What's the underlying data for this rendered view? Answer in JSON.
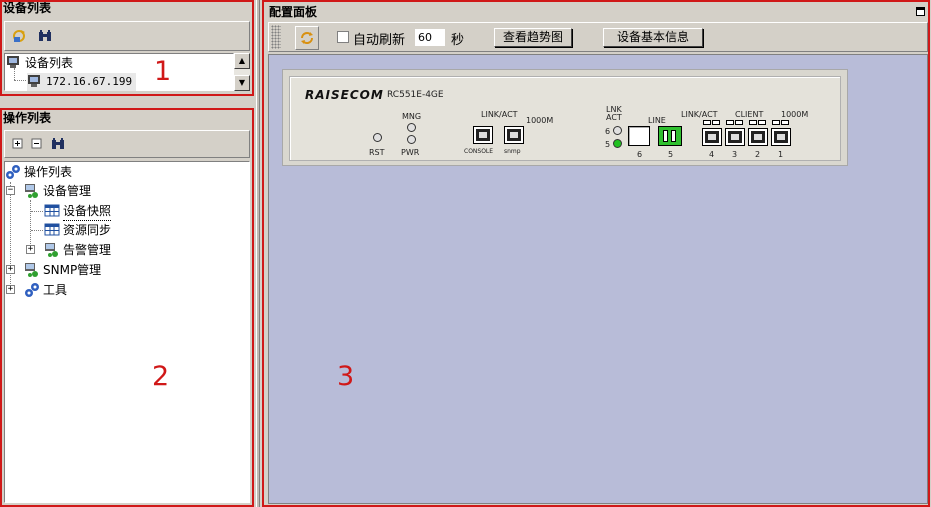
{
  "device_list_panel": {
    "title": "设备列表",
    "tree": {
      "root_label": "设备列表",
      "device_ip": "172.16.67.199"
    }
  },
  "operation_list_panel": {
    "title": "操作列表",
    "tree": {
      "root": "操作列表",
      "device_mgmt": "设备管理",
      "device_snapshot": "设备快照",
      "resource_sync": "资源同步",
      "alarm_mgmt": "告警管理",
      "snmp_mgmt": "SNMP管理",
      "tools": "工具"
    }
  },
  "config_panel": {
    "title": "配置面板",
    "auto_refresh_label": "自动刷新",
    "auto_refresh_checked": false,
    "refresh_interval": "60",
    "seconds_label": "秒",
    "trend_button": "查看趋势图",
    "device_info_button": "设备基本信息"
  },
  "device": {
    "brand": "RAISECOM",
    "model": "RC551E-4GE",
    "labels": {
      "mng": "MNG",
      "rst": "RST",
      "pwr": "PWR",
      "link_act_left": "LINK/ACT",
      "speed_left": "1000M",
      "console": "CONSOLE",
      "snmp": "snmp",
      "lnk": "LNK",
      "act": "ACT",
      "led6": "6",
      "led5": "5",
      "line": "LINE",
      "port6": "6",
      "port5": "5",
      "link_act_right": "LINK/ACT",
      "client": "CLIENT",
      "speed_right": "1000M",
      "p4": "4",
      "p3": "3",
      "p2": "2",
      "p1": "1"
    }
  },
  "annotations": {
    "n1": "1",
    "n2": "2",
    "n3": "3"
  },
  "colors": {
    "highlight_red": "#d01818",
    "config_background": "#b8bcd8",
    "led_green": "#20c020"
  }
}
